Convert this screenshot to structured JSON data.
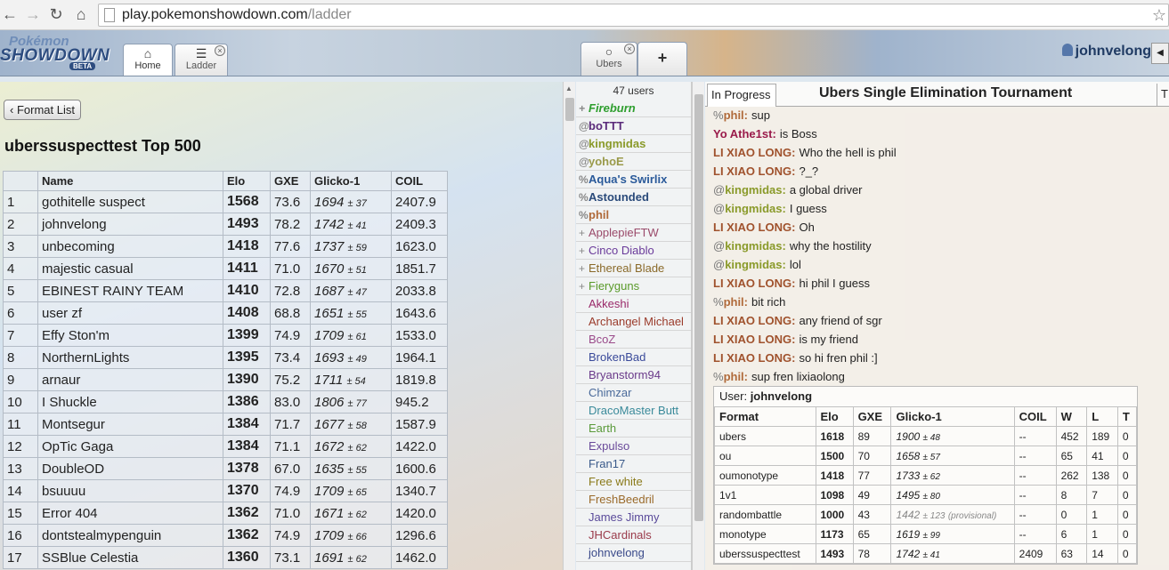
{
  "browser": {
    "url_host": "play.pokemonshowdown.com",
    "url_path": "/ladder"
  },
  "header": {
    "logo": {
      "line1": "Pokémon",
      "line2": "SHOWDOWN",
      "badge": "BETA"
    },
    "tabs": [
      {
        "label": "Home",
        "icon": "home-icon"
      },
      {
        "label": "Ladder",
        "icon": "list-icon"
      },
      {
        "label": "Ubers",
        "icon": "chat-bubble-icon"
      },
      {
        "label": "+"
      }
    ],
    "username": "johnvelong"
  },
  "ladder": {
    "format_list_button": "Format List",
    "title": "uberssuspecttest Top 500",
    "columns": [
      "",
      "Name",
      "Elo",
      "GXE",
      "Glicko-1",
      "COIL"
    ],
    "rows": [
      [
        "1",
        "gothitelle suspect",
        "1568",
        "73.6",
        "1694",
        "± 37",
        "2407.9"
      ],
      [
        "2",
        "johnvelong",
        "1493",
        "78.2",
        "1742",
        "± 41",
        "2409.3"
      ],
      [
        "3",
        "unbecoming",
        "1418",
        "77.6",
        "1737",
        "± 59",
        "1623.0"
      ],
      [
        "4",
        "majestic casual",
        "1411",
        "71.0",
        "1670",
        "± 51",
        "1851.7"
      ],
      [
        "5",
        "EBINEST RAINY TEAM",
        "1410",
        "72.8",
        "1687",
        "± 47",
        "2033.8"
      ],
      [
        "6",
        "user zf",
        "1408",
        "68.8",
        "1651",
        "± 55",
        "1643.6"
      ],
      [
        "7",
        "Effy Ston'm",
        "1399",
        "74.9",
        "1709",
        "± 61",
        "1533.0"
      ],
      [
        "8",
        "NorthernLights",
        "1395",
        "73.4",
        "1693",
        "± 49",
        "1964.1"
      ],
      [
        "9",
        "arnaur",
        "1390",
        "75.2",
        "1711",
        "± 54",
        "1819.8"
      ],
      [
        "10",
        "I Shuckle",
        "1386",
        "83.0",
        "1806",
        "± 77",
        "945.2"
      ],
      [
        "11",
        "Montsegur",
        "1384",
        "71.7",
        "1677",
        "± 58",
        "1587.9"
      ],
      [
        "12",
        "OpTic Gaga",
        "1384",
        "71.1",
        "1672",
        "± 62",
        "1422.0"
      ],
      [
        "13",
        "DoubleOD",
        "1378",
        "67.0",
        "1635",
        "± 55",
        "1600.6"
      ],
      [
        "14",
        "bsuuuu",
        "1370",
        "74.9",
        "1709",
        "± 65",
        "1340.7"
      ],
      [
        "15",
        "Error 404",
        "1362",
        "71.0",
        "1671",
        "± 62",
        "1420.0"
      ],
      [
        "16",
        "dontstealmypenguin",
        "1362",
        "74.9",
        "1709",
        "± 66",
        "1296.6"
      ],
      [
        "17",
        "SSBlue Celestia",
        "1360",
        "73.1",
        "1691",
        "± 62",
        "1462.0"
      ]
    ]
  },
  "userlist": {
    "count": "47 users",
    "users": [
      {
        "rank": "+",
        "name": "Fireburn",
        "color": "#2e9e2e",
        "style": "bi"
      },
      {
        "rank": "@",
        "name": "boTTT",
        "color": "#5a2a7a",
        "style": "b"
      },
      {
        "rank": "@",
        "name": "kingmidas",
        "color": "#8a9a2a",
        "style": "b"
      },
      {
        "rank": "@",
        "name": "yohoE",
        "color": "#9a9a4a",
        "style": "b"
      },
      {
        "rank": "%",
        "name": "Aqua's Swirlix",
        "color": "#2a5a9a",
        "style": "b"
      },
      {
        "rank": "%",
        "name": "Astounded",
        "color": "#2a4a7a",
        "style": "b"
      },
      {
        "rank": "%",
        "name": "phil",
        "color": "#b06a3a",
        "style": "b"
      },
      {
        "rank": "+",
        "name": "ApplepieFTW",
        "color": "#9a4a6a",
        "style": ""
      },
      {
        "rank": "+",
        "name": "Cinco Diablo",
        "color": "#6a3a9a",
        "style": ""
      },
      {
        "rank": "+",
        "name": "Ethereal Blade",
        "color": "#8a6a2a",
        "style": ""
      },
      {
        "rank": "+",
        "name": "Fieryguns",
        "color": "#5a9a2a",
        "style": ""
      },
      {
        "rank": "",
        "name": "Akkeshi",
        "color": "#9a2a6a",
        "style": ""
      },
      {
        "rank": "",
        "name": "Archangel Michael",
        "color": "#9a3a2a",
        "style": ""
      },
      {
        "rank": "",
        "name": "BcoZ",
        "color": "#9a4a8a",
        "style": ""
      },
      {
        "rank": "",
        "name": "BrokenBad",
        "color": "#3a4a9a",
        "style": ""
      },
      {
        "rank": "",
        "name": "Bryanstorm94",
        "color": "#6a3a8a",
        "style": ""
      },
      {
        "rank": "",
        "name": "Chimzar",
        "color": "#4a6a9a",
        "style": ""
      },
      {
        "rank": "",
        "name": "DracoMaster Butt",
        "color": "#3a8a9a",
        "style": ""
      },
      {
        "rank": "",
        "name": "Earth",
        "color": "#5a9a3a",
        "style": ""
      },
      {
        "rank": "",
        "name": "Expulso",
        "color": "#6a4a9a",
        "style": ""
      },
      {
        "rank": "",
        "name": "Fran17",
        "color": "#3a5a8a",
        "style": ""
      },
      {
        "rank": "",
        "name": "Free white",
        "color": "#8a7a1a",
        "style": ""
      },
      {
        "rank": "",
        "name": "FreshBeedril",
        "color": "#9a6a2a",
        "style": ""
      },
      {
        "rank": "",
        "name": "James Jimmy",
        "color": "#5a4a9a",
        "style": ""
      },
      {
        "rank": "",
        "name": "JHCardinals",
        "color": "#9a3a4a",
        "style": ""
      },
      {
        "rank": "",
        "name": "johnvelong",
        "color": "#3a4a8a",
        "style": ""
      }
    ]
  },
  "chat": {
    "tab_in_progress": "In Progress",
    "title": "Ubers Single Elimination Tournament",
    "tab_right": "T",
    "messages": [
      {
        "rank": "%",
        "name": "phil",
        "text": "sup",
        "color": "#b06a3a"
      },
      {
        "rank": "",
        "name": "Yo Athe1st",
        "text": "is Boss",
        "color": "#9a1a4a"
      },
      {
        "rank": "",
        "name": "LI XIAO LONG",
        "text": "Who the hell is phil",
        "color": "#a0522d"
      },
      {
        "rank": "",
        "name": "LI XIAO LONG",
        "text": "?_?",
        "color": "#a0522d"
      },
      {
        "rank": "@",
        "name": "kingmidas",
        "text": "a global driver",
        "color": "#8a9a2a"
      },
      {
        "rank": "@",
        "name": "kingmidas",
        "text": "I guess",
        "color": "#8a9a2a"
      },
      {
        "rank": "",
        "name": "LI XIAO LONG",
        "text": "Oh",
        "color": "#a0522d"
      },
      {
        "rank": "@",
        "name": "kingmidas",
        "text": "why the hostility",
        "color": "#8a9a2a"
      },
      {
        "rank": "@",
        "name": "kingmidas",
        "text": "lol",
        "color": "#8a9a2a"
      },
      {
        "rank": "",
        "name": "LI XIAO LONG",
        "text": "hi phil I guess",
        "color": "#a0522d"
      },
      {
        "rank": "%",
        "name": "phil",
        "text": "bit rich",
        "color": "#b06a3a"
      },
      {
        "rank": "",
        "name": "LI XIAO LONG",
        "text": "any friend of sgr",
        "color": "#a0522d"
      },
      {
        "rank": "",
        "name": "LI XIAO LONG",
        "text": "is my friend",
        "color": "#a0522d"
      },
      {
        "rank": "",
        "name": "LI XIAO LONG",
        "text": "so hi fren phil :]",
        "color": "#a0522d"
      },
      {
        "rank": "%",
        "name": "phil",
        "text": "sup fren lixiaolong",
        "color": "#b06a3a"
      }
    ],
    "user_card": {
      "label": "User:",
      "username": "johnvelong",
      "columns": [
        "Format",
        "Elo",
        "GXE",
        "Glicko-1",
        "COIL",
        "W",
        "L",
        "T"
      ],
      "rows": [
        [
          "ubers",
          "1618",
          "89",
          "1900",
          "± 48",
          "",
          "--",
          "452",
          "189",
          "0"
        ],
        [
          "ou",
          "1500",
          "70",
          "1658",
          "± 57",
          "",
          "--",
          "65",
          "41",
          "0"
        ],
        [
          "oumonotype",
          "1418",
          "77",
          "1733",
          "± 62",
          "",
          "--",
          "262",
          "138",
          "0"
        ],
        [
          "1v1",
          "1098",
          "49",
          "1495",
          "± 80",
          "",
          "--",
          "8",
          "7",
          "0"
        ],
        [
          "randombattle",
          "1000",
          "43",
          "1442",
          "± 123",
          "(provisional)",
          "--",
          "0",
          "1",
          "0"
        ],
        [
          "monotype",
          "1173",
          "65",
          "1619",
          "± 99",
          "",
          "--",
          "6",
          "1",
          "0"
        ],
        [
          "uberssuspecttest",
          "1493",
          "78",
          "1742",
          "± 41",
          "",
          "2409",
          "63",
          "14",
          "0"
        ]
      ]
    }
  }
}
